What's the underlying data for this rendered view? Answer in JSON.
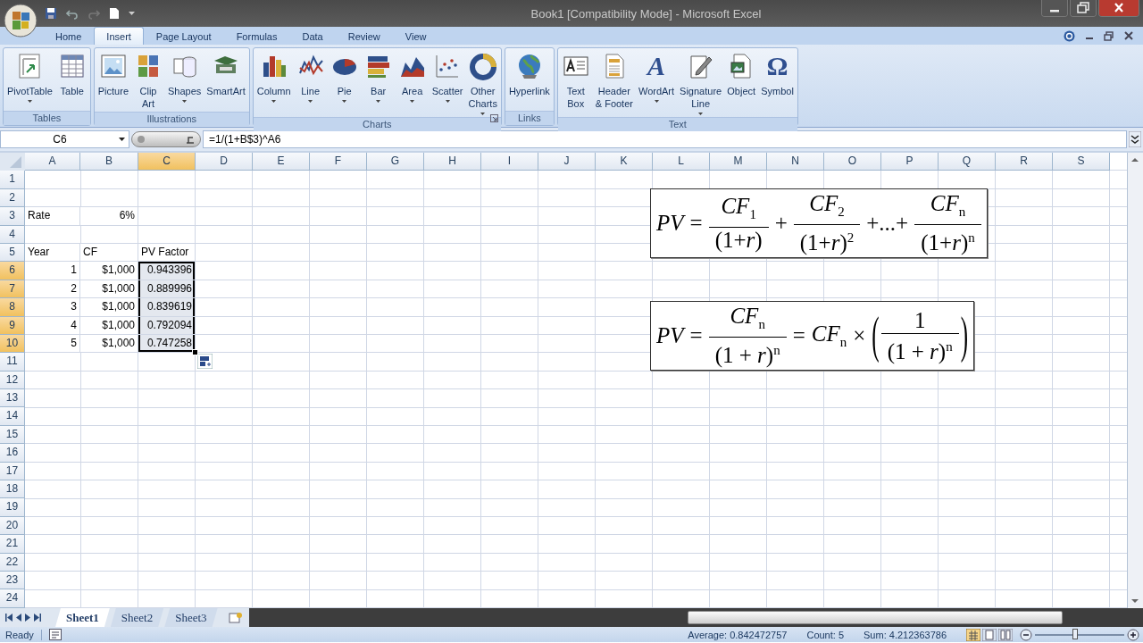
{
  "window": {
    "title": "Book1  [Compatibility Mode] - Microsoft Excel"
  },
  "ribbon_tabs": [
    {
      "label": "Home",
      "selected": false
    },
    {
      "label": "Insert",
      "selected": true
    },
    {
      "label": "Page Layout",
      "selected": false
    },
    {
      "label": "Formulas",
      "selected": false
    },
    {
      "label": "Data",
      "selected": false
    },
    {
      "label": "Review",
      "selected": false
    },
    {
      "label": "View",
      "selected": false
    }
  ],
  "ribbon_groups": [
    {
      "title": "Tables",
      "dialog_launcher": false,
      "buttons": [
        {
          "label": "PivotTable",
          "dropdown": true
        },
        {
          "label": "Table",
          "dropdown": false
        }
      ]
    },
    {
      "title": "Illustrations",
      "dialog_launcher": false,
      "buttons": [
        {
          "label": "Picture",
          "dropdown": false
        },
        {
          "label": "Clip\nArt",
          "dropdown": false
        },
        {
          "label": "Shapes",
          "dropdown": true
        },
        {
          "label": "SmartArt",
          "dropdown": false
        }
      ]
    },
    {
      "title": "Charts",
      "dialog_launcher": true,
      "buttons": [
        {
          "label": "Column",
          "dropdown": true
        },
        {
          "label": "Line",
          "dropdown": true
        },
        {
          "label": "Pie",
          "dropdown": true
        },
        {
          "label": "Bar",
          "dropdown": true
        },
        {
          "label": "Area",
          "dropdown": true
        },
        {
          "label": "Scatter",
          "dropdown": true
        },
        {
          "label": "Other\nCharts",
          "dropdown": true
        }
      ]
    },
    {
      "title": "Links",
      "dialog_launcher": false,
      "buttons": [
        {
          "label": "Hyperlink",
          "dropdown": false
        }
      ]
    },
    {
      "title": "Text",
      "dialog_launcher": false,
      "buttons": [
        {
          "label": "Text\nBox",
          "dropdown": false
        },
        {
          "label": "Header\n& Footer",
          "dropdown": false
        },
        {
          "label": "WordArt",
          "dropdown": true,
          "glyph": "A"
        },
        {
          "label": "Signature\nLine",
          "dropdown": true
        },
        {
          "label": "Object",
          "dropdown": false
        },
        {
          "label": "Symbol",
          "dropdown": false,
          "glyph": "Ω"
        }
      ]
    }
  ],
  "formula_bar": {
    "name_box": "C6",
    "formula": "=1/(1+B$3)^A6"
  },
  "sheet": {
    "columns": [
      {
        "label": "A",
        "selected": false
      },
      {
        "label": "B",
        "selected": false
      },
      {
        "label": "C",
        "selected": true
      },
      {
        "label": "D",
        "selected": false
      },
      {
        "label": "E",
        "selected": false
      },
      {
        "label": "F",
        "selected": false
      },
      {
        "label": "G",
        "selected": false
      },
      {
        "label": "H",
        "selected": false
      },
      {
        "label": "I",
        "selected": false
      },
      {
        "label": "J",
        "selected": false
      },
      {
        "label": "K",
        "selected": false
      },
      {
        "label": "L",
        "selected": false
      },
      {
        "label": "M",
        "selected": false
      },
      {
        "label": "N",
        "selected": false
      },
      {
        "label": "O",
        "selected": false
      },
      {
        "label": "P",
        "selected": false
      },
      {
        "label": "Q",
        "selected": false
      },
      {
        "label": "R",
        "selected": false
      },
      {
        "label": "S",
        "selected": false
      }
    ],
    "rows": [
      {
        "label": "1",
        "selected": false
      },
      {
        "label": "2",
        "selected": false
      },
      {
        "label": "3",
        "selected": false,
        "cells": [
          {
            "text": "Rate",
            "kind": "text",
            "selected": false
          },
          {
            "text": "6%",
            "kind": "number",
            "selected": false
          }
        ]
      },
      {
        "label": "4",
        "selected": false
      },
      {
        "label": "5",
        "selected": false,
        "cells": [
          {
            "text": "Year",
            "kind": "text",
            "selected": false
          },
          {
            "text": "CF",
            "kind": "text",
            "selected": false
          },
          {
            "text": "PV Factor",
            "kind": "text",
            "selected": false
          }
        ]
      },
      {
        "label": "6",
        "selected": true,
        "cells": [
          {
            "text": "1",
            "kind": "number",
            "selected": false
          },
          {
            "text": "$1,000",
            "kind": "number",
            "selected": false
          },
          {
            "text": "0.943396",
            "kind": "number",
            "selected": true
          }
        ]
      },
      {
        "label": "7",
        "selected": true,
        "cells": [
          {
            "text": "2",
            "kind": "number",
            "selected": false
          },
          {
            "text": "$1,000",
            "kind": "number",
            "selected": false
          },
          {
            "text": "0.889996",
            "kind": "number",
            "selected": true
          }
        ]
      },
      {
        "label": "8",
        "selected": true,
        "cells": [
          {
            "text": "3",
            "kind": "number",
            "selected": false
          },
          {
            "text": "$1,000",
            "kind": "number",
            "selected": false
          },
          {
            "text": "0.839619",
            "kind": "number",
            "selected": true
          }
        ]
      },
      {
        "label": "9",
        "selected": true,
        "cells": [
          {
            "text": "4",
            "kind": "number",
            "selected": false
          },
          {
            "text": "$1,000",
            "kind": "number",
            "selected": false
          },
          {
            "text": "0.792094",
            "kind": "number",
            "selected": true
          }
        ]
      },
      {
        "label": "10",
        "selected": true,
        "cells": [
          {
            "text": "5",
            "kind": "number",
            "selected": false
          },
          {
            "text": "$1,000",
            "kind": "number",
            "selected": false
          },
          {
            "text": "0.747258",
            "kind": "number",
            "selected": true
          }
        ]
      },
      {
        "label": "11",
        "selected": false
      },
      {
        "label": "12",
        "selected": false
      },
      {
        "label": "13",
        "selected": false
      },
      {
        "label": "14",
        "selected": false
      },
      {
        "label": "15",
        "selected": false
      },
      {
        "label": "16",
        "selected": false
      },
      {
        "label": "17",
        "selected": false
      },
      {
        "label": "18",
        "selected": false
      },
      {
        "label": "19",
        "selected": false
      },
      {
        "label": "20",
        "selected": false
      },
      {
        "label": "21",
        "selected": false
      },
      {
        "label": "22",
        "selected": false
      },
      {
        "label": "23",
        "selected": false
      },
      {
        "label": "24",
        "selected": false
      }
    ]
  },
  "equations": [
    {
      "items": [
        {
          "kind": "var",
          "text": "PV"
        },
        {
          "kind": "op",
          "text": "="
        },
        {
          "kind": "frac",
          "num": "*CF*$_{1}$",
          "den": "(1+*r*)"
        },
        {
          "kind": "op",
          "text": "+"
        },
        {
          "kind": "frac",
          "num": "*CF*$_{2}$",
          "den": "(1+*r*)$^{2}$"
        },
        {
          "kind": "op",
          "text": "+...+"
        },
        {
          "kind": "frac",
          "num": "*CF*$_{n}$",
          "den": "(1+*r*)$^{n}$"
        }
      ]
    },
    {
      "items": [
        {
          "kind": "var",
          "text": "PV"
        },
        {
          "kind": "op",
          "text": "="
        },
        {
          "kind": "frac",
          "num": "*CF*$_{n}$",
          "den": "(1 + *r*)$^{n}$"
        },
        {
          "kind": "op",
          "text": "="
        },
        {
          "kind": "term",
          "text": "*CF*$_{n}$"
        },
        {
          "kind": "op",
          "text": "×"
        },
        {
          "kind": "paren",
          "open": "(",
          "close": ")",
          "num": "1",
          "den": "(1 + *r*)$^{n}$"
        }
      ]
    }
  ],
  "sheet_tabs": [
    {
      "label": "Sheet1",
      "selected": true
    },
    {
      "label": "Sheet2",
      "selected": false
    },
    {
      "label": "Sheet3",
      "selected": false
    }
  ],
  "status_bar": {
    "mode": "Ready",
    "average": "Average: 0.842472757",
    "count": "Count: 5",
    "sum": "Sum: 4.212363786",
    "zoom": {
      "level": 0.45
    }
  }
}
